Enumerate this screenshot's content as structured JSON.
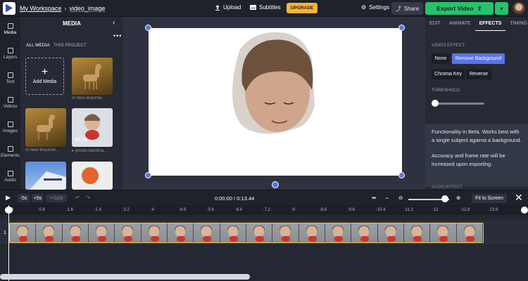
{
  "topbar": {
    "workspace": "My Workspace",
    "separator": "›",
    "project": "video_image",
    "upload": "Upload",
    "subtitles": "Subtitles",
    "upgrade": "UPGRADE",
    "settings": "Settings",
    "share": "Share",
    "export": "Export Video"
  },
  "leftnav": [
    {
      "label": "Media"
    },
    {
      "label": "Layers"
    },
    {
      "label": "Text"
    },
    {
      "label": "Videos"
    },
    {
      "label": "Images"
    },
    {
      "label": "Elements"
    },
    {
      "label": "Audio"
    }
  ],
  "media": {
    "title": "MEDIA",
    "tabs": [
      "ALL MEDIA",
      "THIS PROJECT"
    ],
    "add": "Add Media",
    "labels": [
      "In New Braunfel...",
      "In New Braunfel...",
      "pexels-karolina..."
    ],
    "duration": "00:13"
  },
  "rightpanel": {
    "tabs": [
      "EDIT",
      "ANIMATE",
      "EFFECTS",
      "TIMING"
    ],
    "video_effect": "VIDEO EFFECT",
    "buttons": [
      "None",
      "Remove Background",
      "Chroma Key",
      "Reverse"
    ],
    "threshold": "THRESHOLD",
    "info1": "Functionality in Beta. Works best with a single subject against a background.",
    "info2": "Accuracy and frame rate will be increased upon exporting.",
    "audio_effect": "AUDIO EFFECT"
  },
  "timeline": {
    "back": "-5s",
    "forward": "+5s",
    "split": "Split",
    "time": "0:00.00 / 0:13.44",
    "fit": "Fit to Screen",
    "ticks": [
      ":0",
      ":0.8",
      ":1.6",
      ":2.4",
      ":3.2",
      ":4",
      ":4.8",
      ":5.6",
      ":6.4",
      ":7.2",
      ":8",
      ":8.8",
      ":9.6",
      ":10.4",
      ":11.2",
      ":12",
      ":12.8",
      ":13.6"
    ],
    "track": "1"
  },
  "colors": {
    "accent": "#5a74e6",
    "export": "#27c26b",
    "upgrade": "#f5b43a"
  }
}
